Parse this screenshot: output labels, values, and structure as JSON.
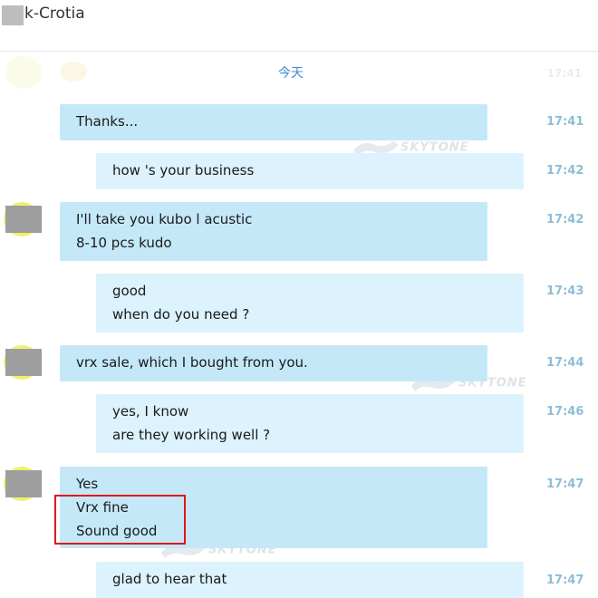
{
  "header": {
    "title": "k-Crotia"
  },
  "date_label": "今天",
  "ghost_time": "17:41",
  "watermark_text": "SKYTONE",
  "messages": [
    {
      "side": "them",
      "avatar": false,
      "lines": [
        "Thanks..."
      ],
      "time": "17:41"
    },
    {
      "side": "me",
      "lines": [
        "how 's your business"
      ],
      "time": "17:42"
    },
    {
      "side": "them",
      "avatar": true,
      "lines": [
        "I'll take you kubo l acustic",
        "8-10 pcs kudo"
      ],
      "time": "17:42"
    },
    {
      "side": "me",
      "lines": [
        "good",
        "when do you need ?"
      ],
      "time": "17:43"
    },
    {
      "side": "them",
      "avatar": true,
      "lines": [
        " vrx sale, which I bought from you."
      ],
      "time": "17:44"
    },
    {
      "side": "me",
      "lines": [
        "yes, I know",
        "are they working well ?"
      ],
      "time": "17:46"
    },
    {
      "side": "them",
      "avatar": true,
      "lines": [
        "Yes",
        "Vrx fine",
        "Sound good"
      ],
      "time": "17:47"
    },
    {
      "side": "me",
      "lines": [
        "glad to hear that"
      ],
      "time": "17:47"
    }
  ]
}
